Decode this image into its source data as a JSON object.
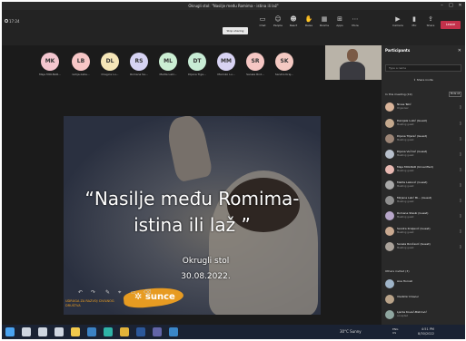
{
  "window": {
    "title": "Okrugli stol: \"Nasilje među Romima - istina ili laž\""
  },
  "toolbar": {
    "timer": "17:24",
    "stop_sharing": "Stop sharing",
    "buttons": [
      {
        "label": "Chat",
        "icon": "chat-icon"
      },
      {
        "label": "People",
        "icon": "people-icon"
      },
      {
        "label": "React",
        "icon": "react-icon"
      },
      {
        "label": "Raise",
        "icon": "hand-icon"
      },
      {
        "label": "Rooms",
        "icon": "rooms-icon"
      },
      {
        "label": "Apps",
        "icon": "apps-icon"
      },
      {
        "label": "More",
        "icon": "more-icon"
      }
    ],
    "right_buttons": [
      {
        "label": "Camera",
        "icon": "camera-icon"
      },
      {
        "label": "Mic",
        "icon": "mic-icon"
      },
      {
        "label": "Share",
        "icon": "share-icon"
      }
    ],
    "leave": "Leave"
  },
  "avatars": [
    {
      "initials": "MK",
      "name": "Maja MOLNAR...",
      "color": "#f3c6cf"
    },
    {
      "initials": "LB",
      "name": "ladija.zaba...",
      "color": "#f7c7c7"
    },
    {
      "initials": "DL",
      "name": "Dragica Lu...",
      "color": "#f5e6b8"
    },
    {
      "initials": "RS",
      "name": "Romana Se...",
      "color": "#d6d3f3"
    },
    {
      "initials": "ML",
      "name": "Melita Laki...",
      "color": "#cbeed3"
    },
    {
      "initials": "DT",
      "name": "Dijana Tiga...",
      "color": "#c8ecd5"
    },
    {
      "initials": "MM",
      "name": "Marinko Lu...",
      "color": "#d8d3f3"
    },
    {
      "initials": "SR",
      "name": "Sanela Rnd...",
      "color": "#f6c7c4"
    },
    {
      "initials": "SK",
      "name": "Sandra Kraj...",
      "color": "#f4c9c2"
    }
  ],
  "slide": {
    "title_line1": "“Nasilje među Romima-",
    "title_line2": "istina ili laž ”",
    "subtitle": "Okrugli stol",
    "date": "30.08.2022.",
    "brand": "sunce",
    "brand_caption": "UDRUGA ZA RAZVOJ CIVILNOG DRUŠTVA"
  },
  "annotation_toolbar": [
    "↶",
    "↷",
    "✎",
    "⌖",
    "▭",
    "⌫"
  ],
  "panel": {
    "title": "Participants",
    "search_placeholder": "Type a name",
    "share_invite": "Share invite",
    "in_meeting_label": "In this meeting (19)",
    "mute_all": "Mute all",
    "participants": [
      {
        "name": "Nives Telić",
        "status": "Organiser",
        "color": "#d9b49a"
      },
      {
        "name": "Danijela Lukić (Guest)",
        "status": "Meeting guest",
        "color": "#c4a98e"
      },
      {
        "name": "Dijana Tiljanić (Guest)",
        "status": "Meeting guest",
        "color": "#9c8576"
      },
      {
        "name": "Dijana Vučinić (Guest)",
        "status": "Meeting guest",
        "color": "#b8c0cc"
      },
      {
        "name": "Maja MOLNAR (Unverified)",
        "status": "Meeting guest",
        "color": "#e8b9b2"
      },
      {
        "name": "Melita Laković (Guest)",
        "status": "Meeting guest",
        "color": "#a9a9a9"
      },
      {
        "name": "Mirjana Lalić Mi... (Guest)",
        "status": "Meeting guest",
        "color": "#8f8f8f"
      },
      {
        "name": "Romana Stasik (Guest)",
        "status": "Meeting guest",
        "color": "#b7a6c9"
      },
      {
        "name": "Sandra Kraljević (Guest)",
        "status": "Meeting guest",
        "color": "#c9a990"
      },
      {
        "name": "Sanela Rončević (Guest)",
        "status": "Meeting guest",
        "color": "#aaa29a"
      }
    ],
    "others_label": "Others invited (3)",
    "others": [
      {
        "name": "Ana Horvat",
        "status": "",
        "color": "#9fb4c8"
      },
      {
        "name": "Vladimir Dravuc",
        "status": "",
        "color": "#b9a389"
      },
      {
        "name": "Ljerka Kovač-Bistrović",
        "status": "Accepted",
        "color": "#8fa6a0"
      }
    ]
  },
  "taskbar": {
    "weather": "30°C Sunny",
    "lang_line1": "ENG",
    "lang_line2": "US",
    "time": "4:51 PM",
    "date": "8/30/2022",
    "icons": [
      {
        "name": "windows-start-icon",
        "color": "#4aa3f0"
      },
      {
        "name": "search-icon",
        "color": "#cfd6e0"
      },
      {
        "name": "cortana-icon",
        "color": "#cfd6e0"
      },
      {
        "name": "task-view-icon",
        "color": "#cfd6e0"
      },
      {
        "name": "file-explorer-icon",
        "color": "#f2c94c"
      },
      {
        "name": "mail-icon",
        "color": "#3b82c4"
      },
      {
        "name": "edge-icon",
        "color": "#2fb3a7"
      },
      {
        "name": "chrome-icon",
        "color": "#e0b23a"
      },
      {
        "name": "word-icon",
        "color": "#2b579a"
      },
      {
        "name": "teams-icon",
        "color": "#6264a7"
      },
      {
        "name": "photos-icon",
        "color": "#3a86c8"
      }
    ]
  }
}
